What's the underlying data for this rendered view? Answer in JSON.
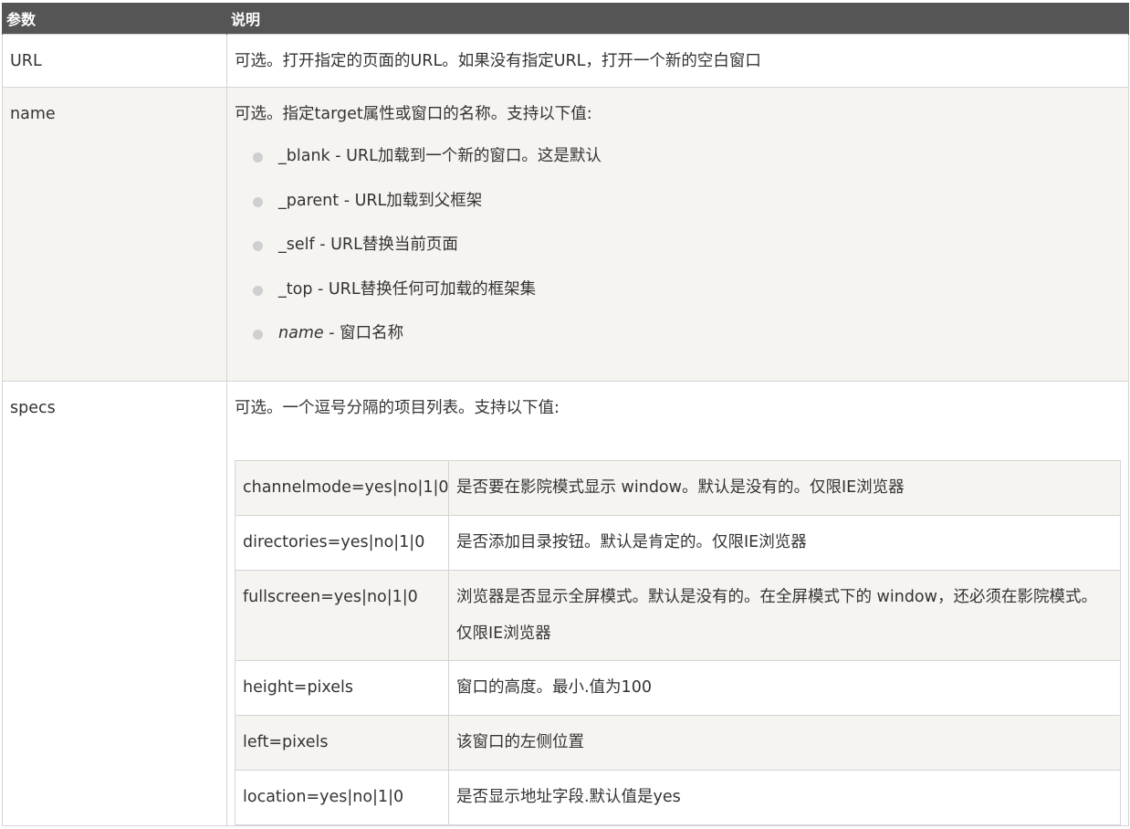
{
  "header": {
    "col_param": "参数",
    "col_desc": "说明"
  },
  "rows": {
    "url": {
      "param": "URL",
      "desc": "可选。打开指定的页面的URL。如果没有指定URL，打开一个新的空白窗口"
    },
    "name": {
      "param": "name",
      "desc": "可选。指定target属性或窗口的名称。支持以下值:",
      "options": [
        {
          "key": "_blank",
          "text": " - URL加载到一个新的窗口。这是默认"
        },
        {
          "key": "_parent",
          "text": " - URL加载到父框架"
        },
        {
          "key": "_self",
          "text": " - URL替换当前页面"
        },
        {
          "key": "_top",
          "text": " - URL替换任何可加载的框架集"
        },
        {
          "key": "name",
          "text": " - 窗口名称",
          "italic": true
        }
      ]
    },
    "specs": {
      "param": "specs",
      "desc": "可选。一个逗号分隔的项目列表。支持以下值:",
      "items": [
        {
          "name": "channelmode=yes|no|1|0",
          "desc": "是否要在影院模式显示 window。默认是没有的。仅限IE浏览器"
        },
        {
          "name": "directories=yes|no|1|0",
          "desc": "是否添加目录按钮。默认是肯定的。仅限IE浏览器"
        },
        {
          "name": "fullscreen=yes|no|1|0",
          "desc": "浏览器是否显示全屏模式。默认是没有的。在全屏模式下的 window，还必须在影院模式。仅限IE浏览器"
        },
        {
          "name": "height=pixels",
          "desc": "窗口的高度。最小.值为100"
        },
        {
          "name": "left=pixels",
          "desc": "该窗口的左侧位置"
        },
        {
          "name": "location=yes|no|1|0",
          "desc": "是否显示地址字段.默认值是yes"
        }
      ]
    }
  }
}
